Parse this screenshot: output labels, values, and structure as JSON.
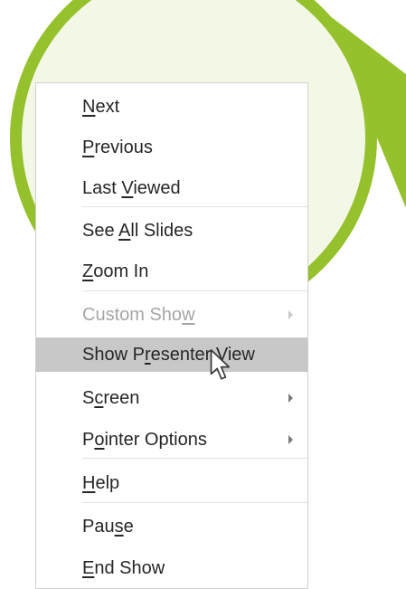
{
  "slide": {
    "accent_color": "#95c12c",
    "fill_color": "#f3f8e6"
  },
  "menu": {
    "items": [
      {
        "pre": "",
        "acc": "N",
        "post": "ext",
        "disabled": false,
        "submenu": false
      },
      {
        "pre": "",
        "acc": "P",
        "post": "revious",
        "disabled": false,
        "submenu": false
      },
      {
        "pre": "Last ",
        "acc": "V",
        "post": "iewed",
        "disabled": false,
        "submenu": false
      },
      {
        "pre": "See ",
        "acc": "A",
        "post": "ll Slides",
        "disabled": false,
        "submenu": false
      },
      {
        "pre": "",
        "acc": "Z",
        "post": "oom In",
        "disabled": false,
        "submenu": false
      },
      {
        "pre": "Custom Sho",
        "acc": "w",
        "post": "",
        "disabled": true,
        "submenu": true
      },
      {
        "pre": "Show P",
        "acc": "r",
        "post": "esenter View",
        "disabled": false,
        "submenu": false,
        "highlighted": true
      },
      {
        "pre": "S",
        "acc": "c",
        "post": "reen",
        "disabled": false,
        "submenu": true
      },
      {
        "pre": "P",
        "acc": "o",
        "post": "inter Options",
        "disabled": false,
        "submenu": true
      },
      {
        "pre": "",
        "acc": "H",
        "post": "elp",
        "disabled": false,
        "submenu": false
      },
      {
        "pre": "Pau",
        "acc": "s",
        "post": "e",
        "disabled": false,
        "submenu": false
      },
      {
        "pre": "",
        "acc": "E",
        "post": "nd Show",
        "disabled": false,
        "submenu": false
      }
    ]
  },
  "cursor": {
    "icon": "arrow-pointer-icon"
  }
}
